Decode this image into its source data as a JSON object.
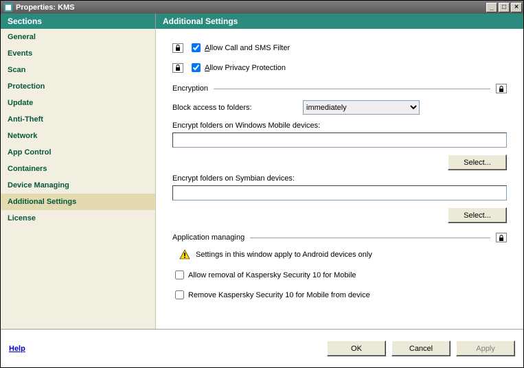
{
  "window": {
    "title": "Properties: KMS"
  },
  "header": {
    "sections": "Sections",
    "panel": "Additional Settings"
  },
  "sidebar": {
    "items": [
      {
        "label": "General",
        "selected": false
      },
      {
        "label": "Events",
        "selected": false
      },
      {
        "label": "Scan",
        "selected": false
      },
      {
        "label": "Protection",
        "selected": false
      },
      {
        "label": "Update",
        "selected": false
      },
      {
        "label": "Anti-Theft",
        "selected": false
      },
      {
        "label": "Network",
        "selected": false
      },
      {
        "label": "App Control",
        "selected": false
      },
      {
        "label": "Containers",
        "selected": false
      },
      {
        "label": "Device Managing",
        "selected": false
      },
      {
        "label": "Additional Settings",
        "selected": true
      },
      {
        "label": "License",
        "selected": false
      }
    ]
  },
  "settings": {
    "allow_call_sms_prefix": "A",
    "allow_call_sms_rest": "llow Call and SMS Filter",
    "allow_privacy_prefix": "A",
    "allow_privacy_rest": "llow Privacy Protection",
    "encryption_group": "Encryption",
    "block_access_label": "Block access to folders:",
    "block_access_options": [
      "immediately"
    ],
    "block_access_value": "immediately",
    "encrypt_wm_label": "Encrypt folders on Windows Mobile devices:",
    "encrypt_wm_value": "",
    "encrypt_sym_label": "Encrypt folders on Symbian devices:",
    "encrypt_sym_value": "",
    "select_btn": "Select...",
    "app_mgmt_group": "Application managing",
    "app_mgmt_note": "Settings in this window apply to Android devices only",
    "allow_removal": "Allow removal of Kaspersky Security 10 for Mobile",
    "remove_ksm": "Remove Kaspersky Security 10 for Mobile from device"
  },
  "footer": {
    "help": "Help",
    "ok": "OK",
    "cancel": "Cancel",
    "apply": "Apply"
  }
}
